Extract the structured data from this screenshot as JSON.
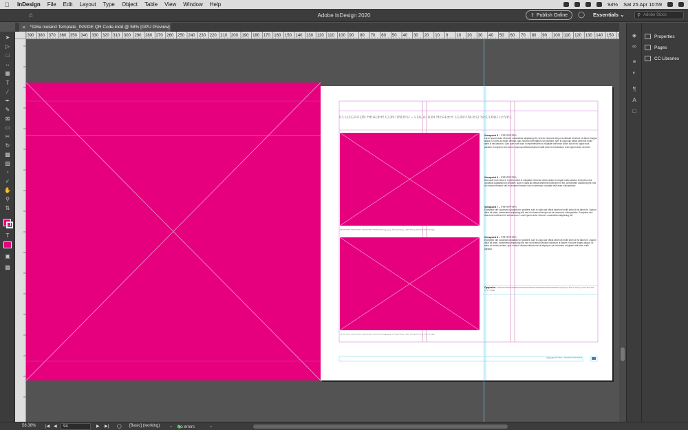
{
  "menubar": {
    "app": "InDesign",
    "items": [
      "File",
      "Edit",
      "Layout",
      "Type",
      "Object",
      "Table",
      "View",
      "Window",
      "Help"
    ],
    "battery": "94%",
    "datetime": "Sat 25 Apr  10:59"
  },
  "appbar": {
    "title": "Adobe InDesign 2020",
    "publish_label": "Publish Online",
    "workspace_label": "Essentials",
    "search_placeholder": "Adobe Stock"
  },
  "document_tab": {
    "label": "*116a Iceland Template_INSIDE QR Code.indd @ 58% [GPU Preview]"
  },
  "ruler": {
    "ticks": [
      "390",
      "380",
      "370",
      "360",
      "350",
      "340",
      "330",
      "320",
      "310",
      "300",
      "290",
      "280",
      "270",
      "260",
      "250",
      "240",
      "230",
      "220",
      "210",
      "200",
      "190",
      "180",
      "170",
      "160",
      "150",
      "140",
      "130",
      "120",
      "110",
      "100",
      "90",
      "80",
      "70",
      "60",
      "50",
      "40",
      "30",
      "20",
      "10",
      "0",
      "10",
      "20",
      "30",
      "40",
      "50",
      "60",
      "70",
      "80",
      "90",
      "100",
      "110",
      "120",
      "130",
      "140",
      "150",
      "160"
    ]
  },
  "right_panel": {
    "items": [
      {
        "label": "Properties",
        "icon": "properties-icon"
      },
      {
        "label": "Pages",
        "icon": "pages-icon"
      },
      {
        "label": "CC Libraries",
        "icon": "cc-libraries-icon"
      }
    ]
  },
  "statusbar": {
    "zoom": "58.38%",
    "page": "94",
    "style": "[Basic] (working)",
    "preflight": "No errors"
  },
  "spread": {
    "header": "01 LOCATION HEADER CONTINUED – LOCATION HEADER CONTINUED SECOND LEVEL",
    "viewpoints": [
      {
        "title": "Viewpoint 5 – ??????????:",
        "body": "Lorem ipsum dolor sit amet, consectetur adipiscing elit, sed do eiusmod tempor incididunt ut labore et dolore magna aliqua. Ut enim ad minim veniam, quis nostrud exercitation non proident, sunt in culpa qui officia deserunt mollit anim id est laborum. Duis aute irure dolor in reprehenderit in voluptate velit esse cillum dolore eu fugiat nulla pariatur. Excepteur sint sunt in culpa qui officia deserunt mollit anim id est laborum orem ipsum dolor sit amet."
      },
      {
        "title": "Viewpoint 6 – ??????????:",
        "body": "Duis aute irure dolor in reprehenderit in voluptate velit esse cillum dolore eu fugiat nulla pariatur. Excepteur sint occaecat cupidatat non proident, sunt in culpa qui officia deserunt mollit anim id est, consectetur adipiscing elit, sed do eiusmod tempor sed do eiusmod tempor ea ea commodo voluptate velit esse nulla pariatur."
      },
      {
        "title": "Viewpoint 7 – ??????????:",
        "body": "Excepteur sint occaecat cupidatat non proident, sunt in culpa qui officia deserunt mollit anim id est laborum. Lipsum dolor sit amet, consectetur adipiscing elit, sed do eiusmod tempor ea ea commodo nulla pariatur. Excepteur sint deserunt mollit anim id est laborum. Lorem ipsum dolor sit amet, consectetur adipiscing elit."
      },
      {
        "title": "Viewpoint 8 – ??????????:",
        "body": "Excepteur sint occaecat cupidatat non proident, sunt in culpa qui officia deserunt mollit anim id est laborum. Lipsum dolor sit amet, consectetur adipiscing elit, sed do eiusmod tempor incididunt ut labore et dolore magna aliqua. Ut enim ad minim veniam, quis nostrud ullamco laboris nisi ut aliquip ex ea commodo voluptate velit esse nulla pariatur."
      }
    ],
    "caption_1": "????????? ????????? ????????? ????????? Camera: ??? at ??mm | f/?? ??? at ??? ??? ??? ?? ISO",
    "caption_2": "????????? ????????? ????????? ????????? Camera: ??? at ??mm | f/?? ??? at ??? ??? ??? ?? ISO",
    "quote_label": "Opposite:",
    "quote_text": "??????????????????????????????????????????????????????? Camera: ??? at ??mm | f/?? ??? ??? ??? ?? ISO",
    "footer_text": "ICELAND ??? ???? · ???? ???? ???? ?????"
  },
  "colors": {
    "magenta": "#e6007e",
    "chrome": "#3c3c3c",
    "pasteboard": "#535353"
  }
}
